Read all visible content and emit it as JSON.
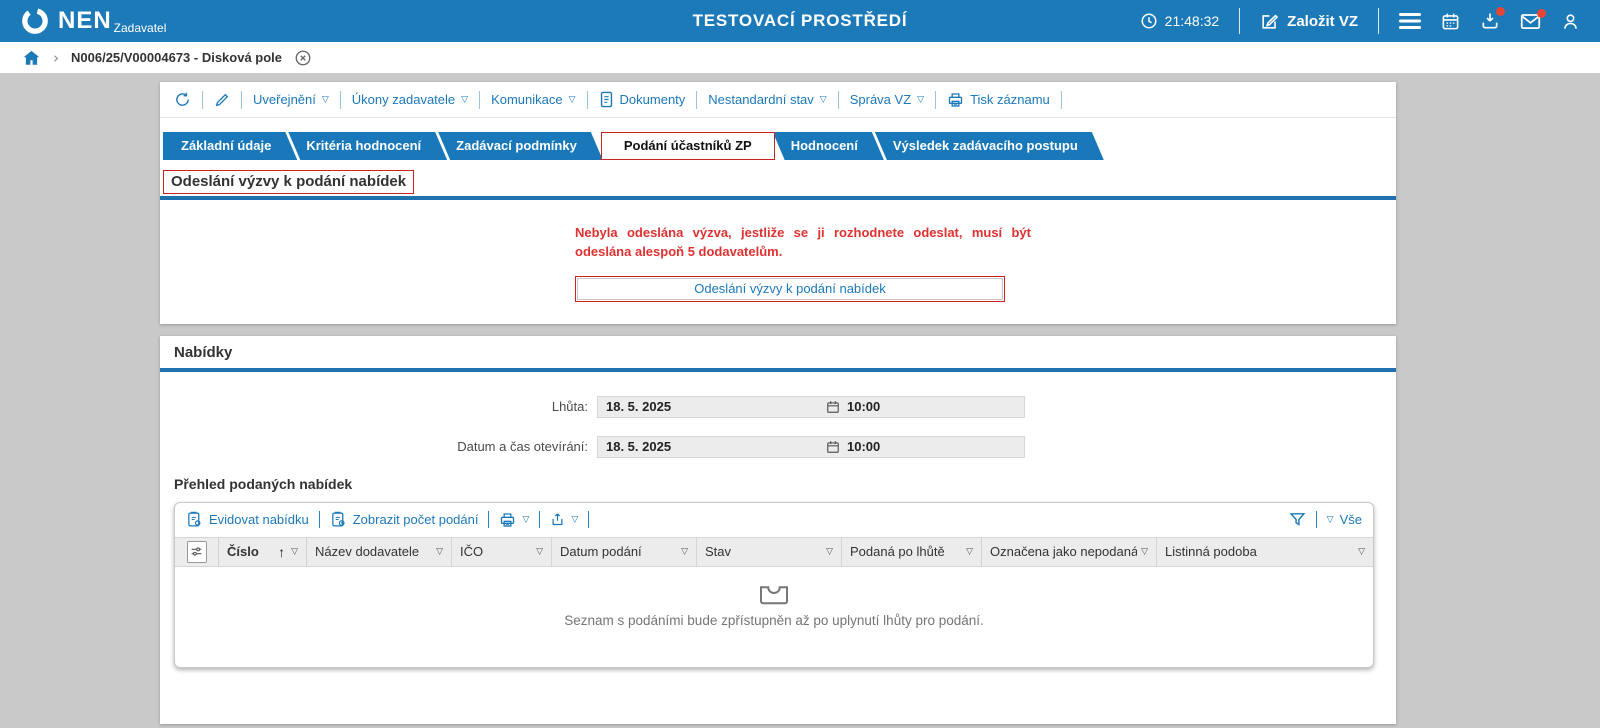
{
  "header": {
    "brand": "NEN",
    "brand_sub": "Zadavatel",
    "environment_title": "TESTOVACÍ PROSTŘEDÍ",
    "clock": "21:48:32",
    "create_vz_label": "Založit VZ"
  },
  "breadcrumb": {
    "item": "N006/25/V00004673 - Disková pole"
  },
  "toolbar": {
    "items": [
      {
        "label": "Uveřejnění",
        "has_caret": true
      },
      {
        "label": "Úkony zadavatele",
        "has_caret": true
      },
      {
        "label": "Komunikace",
        "has_caret": true
      },
      {
        "label": "Dokumenty",
        "has_caret": false
      },
      {
        "label": "Nestandardní stav",
        "has_caret": true
      },
      {
        "label": "Správa VZ",
        "has_caret": true
      },
      {
        "label": "Tisk záznamu",
        "has_caret": false
      }
    ]
  },
  "tabs": {
    "items": [
      "Základní údaje",
      "Kritéria hodnocení",
      "Zadávací podmínky",
      "Podání účastníků ZP",
      "Hodnocení",
      "Výsledek zadávacího postupu"
    ],
    "active": "Podání účastníků ZP"
  },
  "invite_section": {
    "title": "Odeslání výzvy k podání nabídek",
    "warning": "Nebyla odeslána výzva, jestliže se ji rozhodnete odeslat, musí být odeslána alespoň 5 dodavatelům.",
    "button_label": "Odeslání výzvy k podání nabídek"
  },
  "bids_section": {
    "title": "Nabídky",
    "fields": [
      {
        "label": "Lhůta:",
        "date": "18. 5. 2025",
        "time": "10:00"
      },
      {
        "label": "Datum a čas otevírání:",
        "date": "18. 5. 2025",
        "time": "10:00"
      }
    ],
    "table_title": "Přehled podaných nabídek",
    "table": {
      "action_register": "Evidovat nabídku",
      "action_show_count": "Zobrazit počet podání",
      "filter_all_label": "Vše",
      "columns": [
        "Číslo",
        "Název dodavatele",
        "IČO",
        "Datum podání",
        "Stav",
        "Podaná po lhůtě",
        "Označena jako nepodaná",
        "Listinná podoba"
      ],
      "sorted_column": "Číslo",
      "sort_direction": "ascending",
      "empty_message": "Seznam s podáními bude zpřístupněn až po uplynutí lhůty pro podání."
    }
  },
  "colors": {
    "header_blue": "#1d7ab9",
    "tab_blue": "#1878b9",
    "rule_blue": "#1f72ad",
    "link_blue": "#1b79ba",
    "alert_red": "#e03131",
    "highlight_border_red": "#cc2222",
    "badge_red": "#e64533",
    "page_background": "#c9c9c9",
    "field_background": "#ececec"
  }
}
